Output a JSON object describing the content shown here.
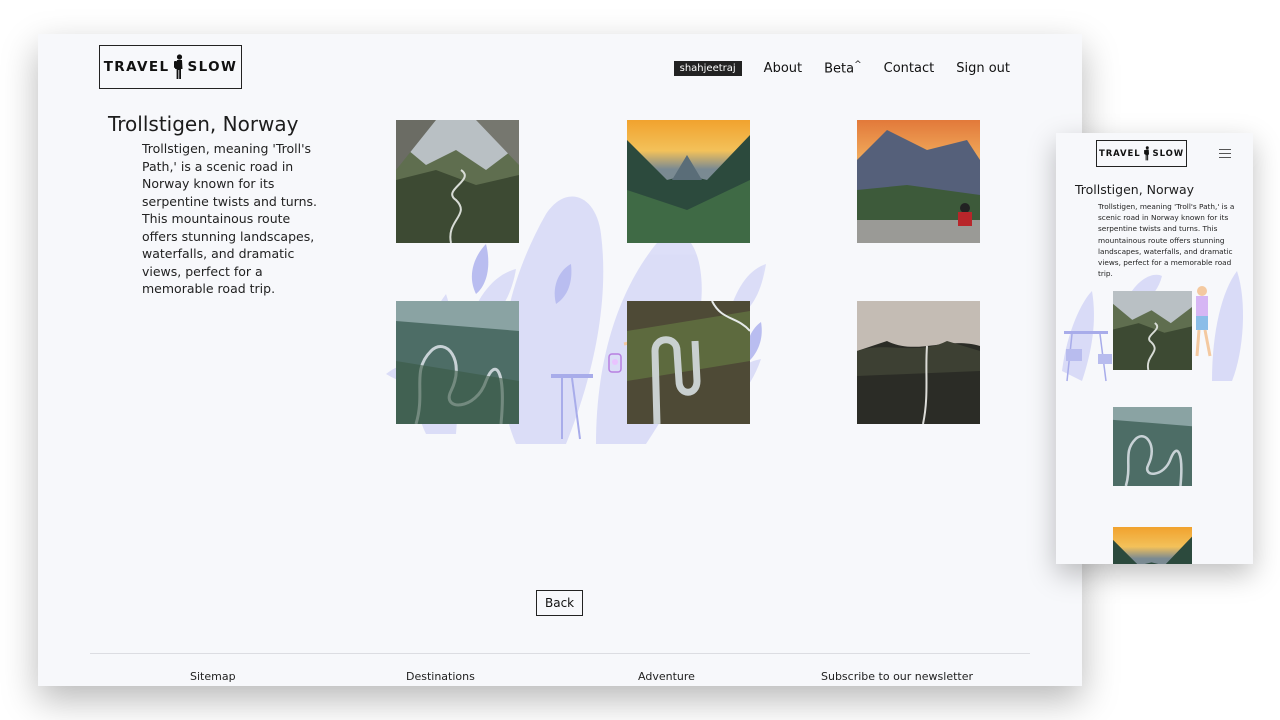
{
  "brand": {
    "logo_left": "TRAVEL",
    "logo_right": "SLOW"
  },
  "nav": {
    "username": "shahjeetraj",
    "about": "About",
    "beta": "Beta",
    "beta_mark": "^",
    "contact": "Contact",
    "sign_out": "Sign out"
  },
  "destination": {
    "title": "Trollstigen, Norway",
    "description": "Trollstigen, meaning 'Troll's Path,' is a scenic road in Norway known for its serpentine twists and turns. This mountainous route offers stunning landscapes, waterfalls, and dramatic views, perfect for a memorable road trip."
  },
  "gallery": {
    "photos": [
      {
        "name": "valley-road-photo"
      },
      {
        "name": "sunset-valley-photo"
      },
      {
        "name": "hiker-sunset-photo"
      },
      {
        "name": "serpentine-road-photo"
      },
      {
        "name": "aerial-switchback-photo"
      },
      {
        "name": "foggy-waterfall-photo"
      }
    ]
  },
  "actions": {
    "back": "Back"
  },
  "footer": {
    "sitemap": "Sitemap",
    "destinations": "Destinations",
    "adventure": "Adventure",
    "newsletter": "Subscribe to our newsletter"
  },
  "mobile": {
    "menu_icon": "hamburger-icon"
  },
  "colors": {
    "background": "#f7f8fb",
    "text": "#111111",
    "illustration": "#c7caf4",
    "chip": "#222222"
  }
}
